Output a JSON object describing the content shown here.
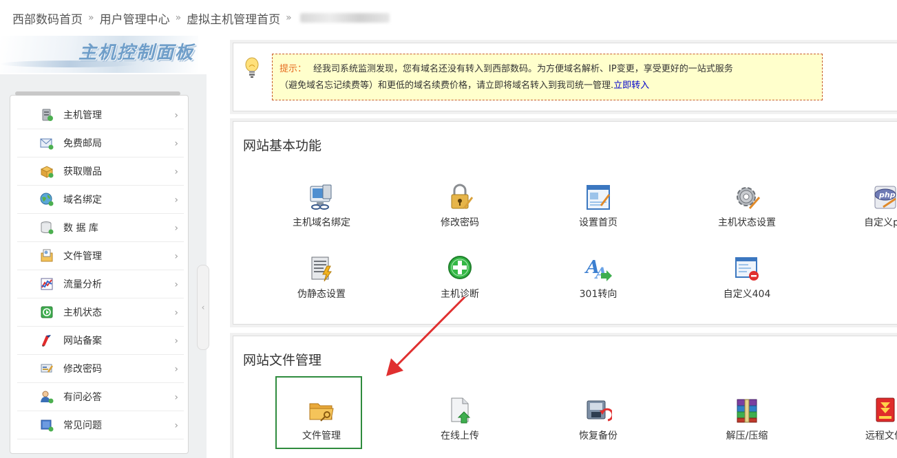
{
  "breadcrumb": {
    "items": [
      "西部数码首页",
      "用户管理中心",
      "虚拟主机管理首页"
    ],
    "separator": "»"
  },
  "panel": {
    "logo_text": "主机控制面板"
  },
  "sidebar": {
    "items": [
      {
        "label": "主机管理",
        "icon": "server-icon"
      },
      {
        "label": "免费邮局",
        "icon": "mail-icon"
      },
      {
        "label": "获取赠品",
        "icon": "gift-icon"
      },
      {
        "label": "域名绑定",
        "icon": "globe-icon"
      },
      {
        "label": "数 据 库",
        "icon": "database-icon"
      },
      {
        "label": "文件管理",
        "icon": "file-manage-icon"
      },
      {
        "label": "流量分析",
        "icon": "traffic-chart-icon"
      },
      {
        "label": "主机状态",
        "icon": "status-icon"
      },
      {
        "label": "网站备案",
        "icon": "record-icon"
      },
      {
        "label": "修改密码",
        "icon": "password-icon"
      },
      {
        "label": "有问必答",
        "icon": "qa-icon"
      },
      {
        "label": "常见问题",
        "icon": "faq-icon"
      }
    ],
    "chevron": "›",
    "collapse_glyph": "‹"
  },
  "notice": {
    "tip_label": "提示：",
    "line1": "经我司系统监测发现，您有域名还没有转入到西部数码。为方便域名解析、IP变更，享受更好的一站式服务",
    "line2": "（避免域名忘记续费等）和更低的域名续费价格，请立即将域名转入到我司统一管理.",
    "link_text": "立即转入"
  },
  "basic_functions": {
    "title": "网站基本功能",
    "tiles": [
      {
        "label": "主机域名绑定",
        "icon": "computer-network-icon"
      },
      {
        "label": "修改密码",
        "icon": "lock-icon"
      },
      {
        "label": "设置首页",
        "icon": "homepage-icon"
      },
      {
        "label": "主机状态设置",
        "icon": "gear-icon"
      },
      {
        "label": "自定义ph",
        "icon": "php-icon"
      },
      {
        "label": "伪静态设置",
        "icon": "rewrite-icon"
      },
      {
        "label": "主机诊断",
        "icon": "plus-circle-icon"
      },
      {
        "label": "301转向",
        "icon": "redirect-icon"
      },
      {
        "label": "自定义404",
        "icon": "error-page-icon"
      }
    ]
  },
  "file_management": {
    "title": "网站文件管理",
    "tiles": [
      {
        "label": "文件管理",
        "icon": "folder-icon"
      },
      {
        "label": "在线上传",
        "icon": "upload-icon"
      },
      {
        "label": "恢复备份",
        "icon": "backup-restore-icon"
      },
      {
        "label": "解压/压缩",
        "icon": "archive-icon"
      },
      {
        "label": "远程文件",
        "icon": "remote-file-icon"
      }
    ]
  },
  "colors": {
    "notice_bg": "#ffffcc",
    "notice_border": "#c85a2a",
    "tip_color": "#e66a1e",
    "link_color": "#0000cc",
    "highlight_border": "#2e8b3d",
    "arrow_color": "#e03030"
  }
}
